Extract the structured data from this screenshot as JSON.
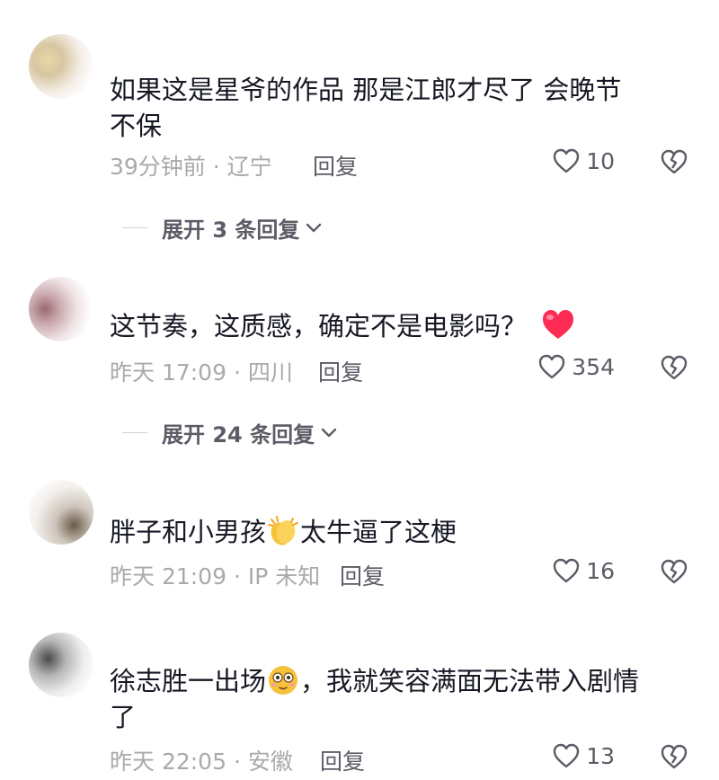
{
  "comments": [
    {
      "text_a": "如果这是星爷的作品  那是江郎才尽了  会晚节",
      "text_b": "不保",
      "time": "39分钟前 · 辽宁",
      "reply": "回复",
      "likes": "10"
    },
    {
      "text_a": "这节奏，这质感，确定不是电影吗？",
      "emoji": "red-heart",
      "time": "昨天 17:09 · 四川",
      "reply": "回复",
      "likes": "354"
    },
    {
      "text_a": "胖子和小男孩",
      "emoji": "clapping-hands",
      "text_b": "太牛逼了这梗",
      "time": "昨天 21:09 · IP 未知",
      "reply": "回复",
      "likes": "16"
    },
    {
      "text_a": "徐志胜一出场",
      "emoji": "flushed-face",
      "text_b": "，我就笑容满面无法带入剧情",
      "text_c": "了",
      "time": "昨天 22:05 · 安徽",
      "reply": "回复",
      "likes": "13"
    }
  ],
  "expand_replies": [
    "展开 3 条回复",
    "展开 24 条回复"
  ],
  "colors": {
    "text": "#161823",
    "meta": "#a9a9ae",
    "action": "#5b5c66",
    "heart": "#fe2c55"
  }
}
